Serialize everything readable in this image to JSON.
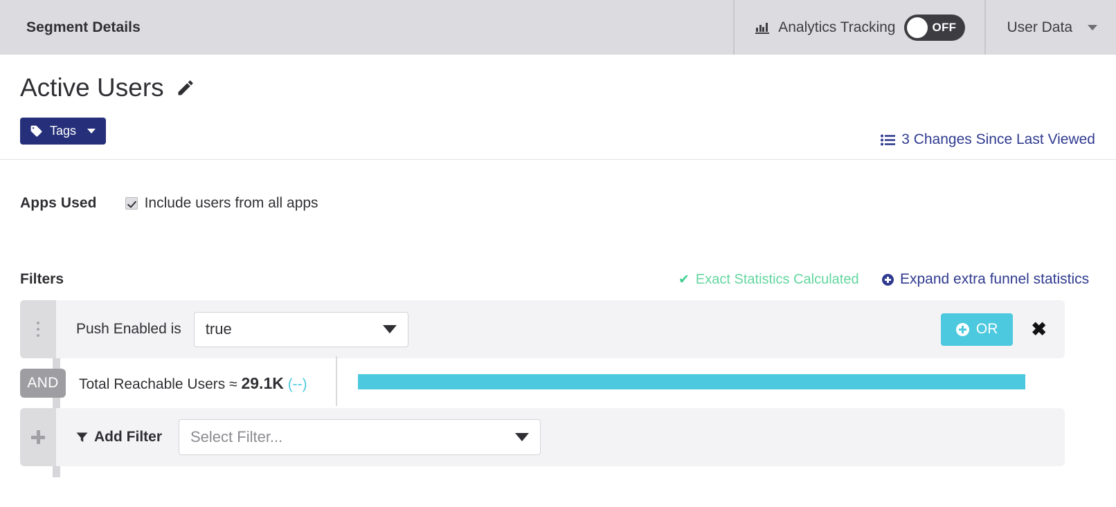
{
  "topbar": {
    "title": "Segment Details",
    "analytics": {
      "icon": "bar-chart-icon",
      "label": "Analytics Tracking",
      "toggle_state": "OFF"
    },
    "user_data": {
      "label": "User Data",
      "icon": "chevron-down-icon"
    }
  },
  "title_section": {
    "segment_name": "Active Users",
    "edit_icon": "pencil-icon",
    "tags_button": {
      "label": "Tags",
      "icon": "tag-icon",
      "caret": "caret-down-icon",
      "color": "#26307a"
    },
    "changes_link": {
      "label": "3 Changes Since Last Viewed",
      "icon": "list-icon",
      "color": "#2f3a8f"
    }
  },
  "apps_used": {
    "label": "Apps Used",
    "checkbox_label": "Include users from all apps",
    "checked": true
  },
  "filters": {
    "title": "Filters",
    "exact_stats": {
      "label": "Exact Statistics Calculated",
      "icon": "check-icon",
      "color": "#62d69f"
    },
    "expand_link": {
      "label": "Expand extra funnel statistics",
      "icon": "plus-circle-icon",
      "color": "#2f3a8f"
    },
    "rows": [
      {
        "handle_icon": "drag-handle-icon",
        "condition_label": "Push Enabled is",
        "value": "true",
        "or_button": {
          "label": "OR",
          "icon": "plus-circle-icon",
          "color": "#4cc9de"
        },
        "remove_icon": "close-icon"
      }
    ],
    "operator_badge": "AND",
    "stats": {
      "label": "Total Reachable Users ≈ ",
      "value": "29.1K",
      "delta": "(--)",
      "bar_color": "#4cc9de",
      "bar_percent": 100
    },
    "add_filter": {
      "icon": "funnel-icon",
      "plus_icon": "plus-icon",
      "label": "Add Filter",
      "placeholder": "Select Filter..."
    }
  }
}
